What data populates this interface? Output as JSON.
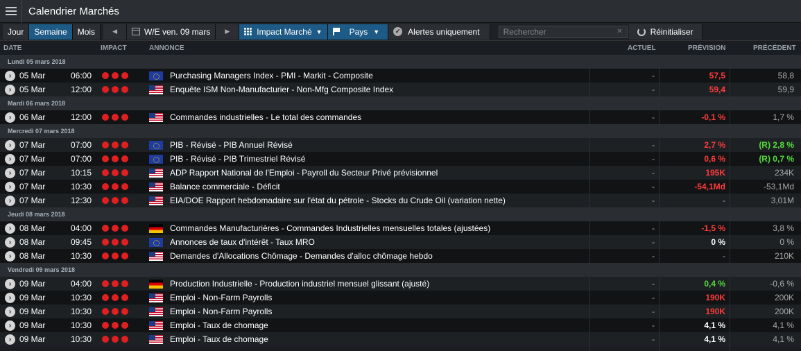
{
  "title": "Calendrier Marchés",
  "toolbar": {
    "jour": "Jour",
    "semaine": "Semaine",
    "mois": "Mois",
    "date_range": "W/E ven. 09 mars",
    "impact": "Impact Marché",
    "pays": "Pays",
    "alertes": "Alertes uniquement",
    "search_placeholder": "Rechercher",
    "reset": "Réinitialiser"
  },
  "columns": {
    "date": "DATE",
    "impact": "IMPACT",
    "annonce": "ANNONCE",
    "actuel": "ACTUEL",
    "prevision": "PRÉVISION",
    "precedent": "PRÉCÉDENT"
  },
  "groups": [
    {
      "label": "Lundi 05 mars 2018",
      "rows": [
        {
          "date": "05 Mar",
          "time": "06:00",
          "flag": "eu",
          "announcement": "Purchasing Managers Index - PMI - Markit - Composite",
          "actual": "-",
          "forecast": "57,5",
          "forecast_color": "red",
          "previous": "58,8",
          "previous_color": "grey"
        },
        {
          "date": "05 Mar",
          "time": "12:00",
          "flag": "us",
          "announcement": "Enquête ISM Non-Manufacturier - Non-Mfg Composite Index",
          "actual": "-",
          "forecast": "59,4",
          "forecast_color": "red",
          "previous": "59,9",
          "previous_color": "grey"
        }
      ]
    },
    {
      "label": "Mardi 06 mars 2018",
      "rows": [
        {
          "date": "06 Mar",
          "time": "12:00",
          "flag": "us",
          "announcement": "Commandes industrielles - Le total des commandes",
          "actual": "-",
          "forecast": "-0,1 %",
          "forecast_color": "red",
          "previous": "1,7 %",
          "previous_color": "grey"
        }
      ]
    },
    {
      "label": "Mercredi 07 mars 2018",
      "rows": [
        {
          "date": "07 Mar",
          "time": "07:00",
          "flag": "eu",
          "announcement": "PIB - Révisé - PIB Annuel Révisé",
          "actual": "-",
          "forecast": "2,7 %",
          "forecast_color": "red",
          "previous": "(R) 2,8 %",
          "previous_color": "green"
        },
        {
          "date": "07 Mar",
          "time": "07:00",
          "flag": "eu",
          "announcement": "PIB - Révisé - PIB Trimestriel Révisé",
          "actual": "-",
          "forecast": "0,6 %",
          "forecast_color": "red",
          "previous": "(R) 0,7 %",
          "previous_color": "green"
        },
        {
          "date": "07 Mar",
          "time": "10:15",
          "flag": "us",
          "announcement": "ADP Rapport National de l'Emploi - Payroll du Secteur Privé prévisionnel",
          "actual": "-",
          "forecast": "195K",
          "forecast_color": "red",
          "previous": "234K",
          "previous_color": "grey"
        },
        {
          "date": "07 Mar",
          "time": "10:30",
          "flag": "us",
          "announcement": "Balance commerciale - Déficit",
          "actual": "-",
          "forecast": "-54,1Md",
          "forecast_color": "red",
          "previous": "-53,1Md",
          "previous_color": "grey"
        },
        {
          "date": "07 Mar",
          "time": "12:30",
          "flag": "us",
          "announcement": "EIA/DOE Rapport hebdomadaire sur l'état du pétrole - Stocks du Crude Oil (variation nette)",
          "actual": "-",
          "forecast": "-",
          "forecast_color": "grey",
          "previous": "3,01M",
          "previous_color": "grey"
        }
      ]
    },
    {
      "label": "Jeudi 08 mars 2018",
      "rows": [
        {
          "date": "08 Mar",
          "time": "04:00",
          "flag": "de",
          "announcement": "Commandes Manufacturières - Commandes Industrielles mensuelles totales (ajustées)",
          "actual": "-",
          "forecast": "-1,5 %",
          "forecast_color": "red",
          "previous": "3,8 %",
          "previous_color": "grey"
        },
        {
          "date": "08 Mar",
          "time": "09:45",
          "flag": "eu",
          "announcement": "Annonces de taux d'intérêt - Taux MRO",
          "actual": "-",
          "forecast": "0 %",
          "forecast_color": "white",
          "previous": "0 %",
          "previous_color": "grey"
        },
        {
          "date": "08 Mar",
          "time": "10:30",
          "flag": "us",
          "announcement": "Demandes d'Allocations Chômage - Demandes d'alloc chômage hebdo",
          "actual": "-",
          "forecast": "-",
          "forecast_color": "grey",
          "previous": "210K",
          "previous_color": "grey"
        }
      ]
    },
    {
      "label": "Vendredi 09 mars 2018",
      "rows": [
        {
          "date": "09 Mar",
          "time": "04:00",
          "flag": "de",
          "announcement": "Production Industrielle - Production industriel mensuel glissant (ajusté)",
          "actual": "-",
          "forecast": "0,4 %",
          "forecast_color": "green",
          "previous": "-0,6 %",
          "previous_color": "grey"
        },
        {
          "date": "09 Mar",
          "time": "10:30",
          "flag": "us",
          "announcement": "Emploi - Non-Farm Payrolls",
          "actual": "-",
          "forecast": "190K",
          "forecast_color": "red",
          "previous": "200K",
          "previous_color": "grey"
        },
        {
          "date": "09 Mar",
          "time": "10:30",
          "flag": "us",
          "announcement": "Emploi - Non-Farm Payrolls",
          "actual": "-",
          "forecast": "190K",
          "forecast_color": "red",
          "previous": "200K",
          "previous_color": "grey"
        },
        {
          "date": "09 Mar",
          "time": "10:30",
          "flag": "us",
          "announcement": "Emploi - Taux de chomage",
          "actual": "-",
          "forecast": "4,1 %",
          "forecast_color": "white",
          "previous": "4,1 %",
          "previous_color": "grey"
        },
        {
          "date": "09 Mar",
          "time": "10:30",
          "flag": "us",
          "announcement": "Emploi - Taux de chomage",
          "actual": "-",
          "forecast": "4,1 %",
          "forecast_color": "white",
          "previous": "4,1 %",
          "previous_color": "grey"
        }
      ]
    }
  ]
}
